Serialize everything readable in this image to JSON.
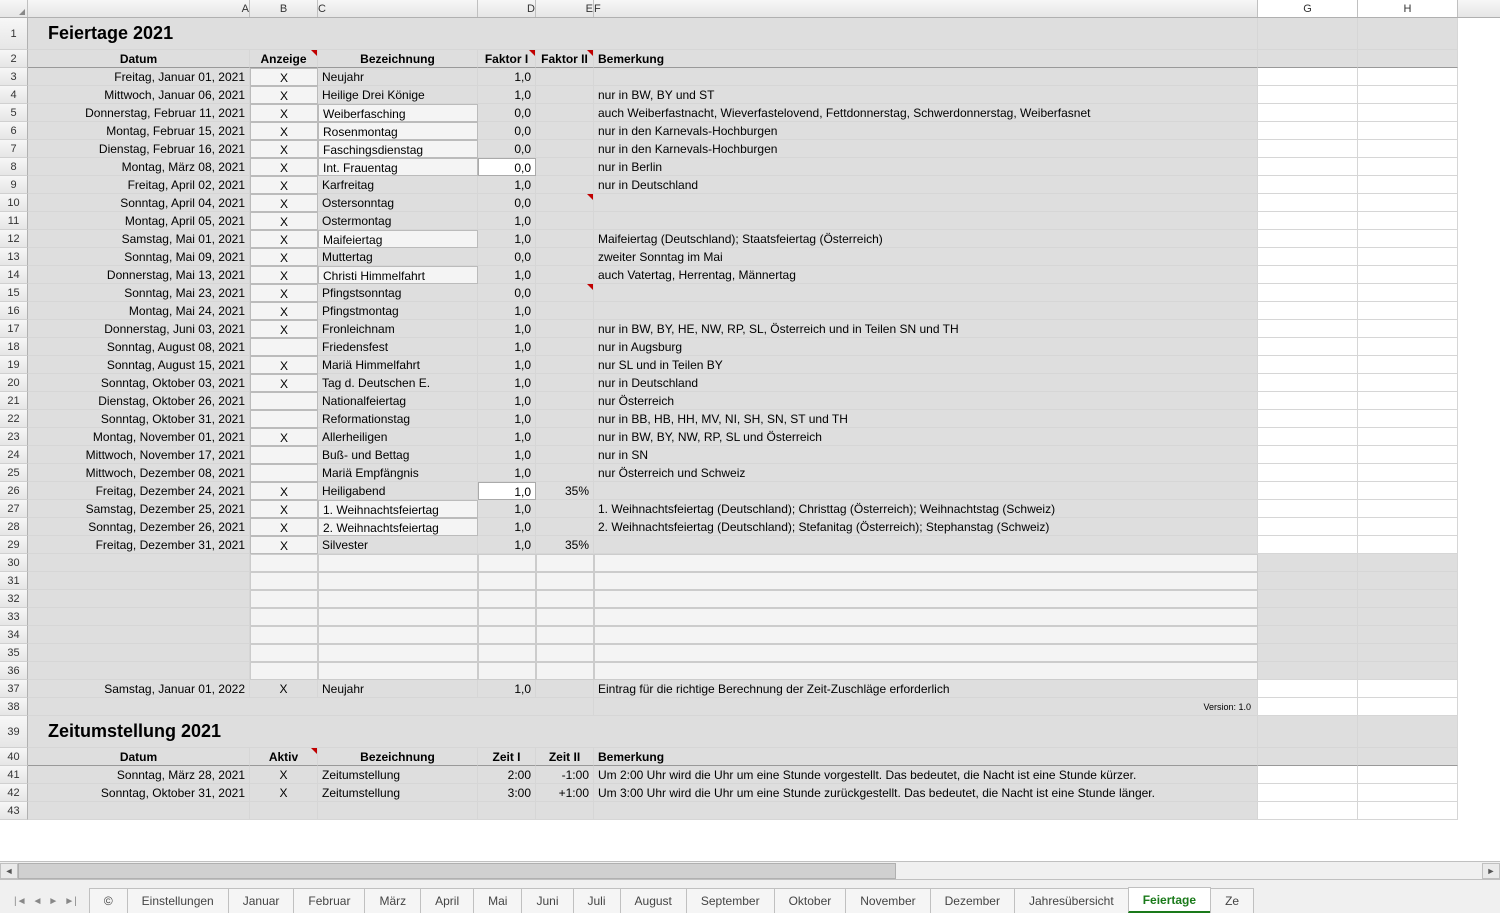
{
  "columns": [
    "A",
    "B",
    "C",
    "D",
    "E",
    "F",
    "G",
    "H"
  ],
  "title1": "Feiertage 2021",
  "title2": "Zeitumstellung 2021",
  "headers1": {
    "a": "Datum",
    "b": "Anzeige",
    "c": "Bezeichnung",
    "d": "Faktor I",
    "e": "Faktor II",
    "f": "Bemerkung"
  },
  "headers2": {
    "a": "Datum",
    "b": "Aktiv",
    "c": "Bezeichnung",
    "d": "Zeit I",
    "e": "Zeit II",
    "f": "Bemerkung"
  },
  "version": "Version: 1.0",
  "rows": [
    {
      "n": 3,
      "a": "Freitag, Januar 01, 2021",
      "b": "X",
      "c": "Neujahr",
      "d": "1,0",
      "e": "",
      "f": ""
    },
    {
      "n": 4,
      "a": "Mittwoch, Januar 06, 2021",
      "b": "X",
      "c": "Heilige Drei Könige",
      "d": "1,0",
      "e": "",
      "f": "nur in BW, BY und ST"
    },
    {
      "n": 5,
      "a": "Donnerstag, Februar 11, 2021",
      "b": "X",
      "c": "Weiberfasching",
      "d": "0,0",
      "e": "",
      "f": "auch Weiberfastnacht, Wieverfastelovend, Fettdonnerstag, Schwerdonnerstag, Weiberfasnet",
      "cedit": true
    },
    {
      "n": 6,
      "a": "Montag, Februar 15, 2021",
      "b": "X",
      "c": "Rosenmontag",
      "d": "0,0",
      "e": "",
      "f": "nur in den Karnevals-Hochburgen",
      "cedit": true
    },
    {
      "n": 7,
      "a": "Dienstag, Februar 16, 2021",
      "b": "X",
      "c": "Faschingsdienstag",
      "d": "0,0",
      "e": "",
      "f": "nur in den Karnevals-Hochburgen",
      "cedit": true
    },
    {
      "n": 8,
      "a": "Montag, März 08, 2021",
      "b": "X",
      "c": "Int. Frauentag",
      "d": "0,0",
      "e": "",
      "f": "nur in Berlin",
      "cedit": true,
      "dwhite": true
    },
    {
      "n": 9,
      "a": "Freitag, April 02, 2021",
      "b": "X",
      "c": "Karfreitag",
      "d": "1,0",
      "e": "",
      "f": "nur in Deutschland"
    },
    {
      "n": 10,
      "a": "Sonntag, April 04, 2021",
      "b": "X",
      "c": "Ostersonntag",
      "d": "0,0",
      "e": "",
      "f": "",
      "emark": true
    },
    {
      "n": 11,
      "a": "Montag, April 05, 2021",
      "b": "X",
      "c": "Ostermontag",
      "d": "1,0",
      "e": "",
      "f": ""
    },
    {
      "n": 12,
      "a": "Samstag, Mai 01, 2021",
      "b": "X",
      "c": "Maifeiertag",
      "d": "1,0",
      "e": "",
      "f": "Maifeiertag (Deutschland); Staatsfeiertag (Österreich)",
      "cedit": true
    },
    {
      "n": 13,
      "a": "Sonntag, Mai 09, 2021",
      "b": "X",
      "c": "Muttertag",
      "d": "0,0",
      "e": "",
      "f": "zweiter Sonntag im Mai"
    },
    {
      "n": 14,
      "a": "Donnerstag, Mai 13, 2021",
      "b": "X",
      "c": "Christi Himmelfahrt",
      "d": "1,0",
      "e": "",
      "f": "auch Vatertag, Herrentag, Männertag",
      "cedit": true
    },
    {
      "n": 15,
      "a": "Sonntag, Mai 23, 2021",
      "b": "X",
      "c": "Pfingstsonntag",
      "d": "0,0",
      "e": "",
      "f": "",
      "emark": true
    },
    {
      "n": 16,
      "a": "Montag, Mai 24, 2021",
      "b": "X",
      "c": "Pfingstmontag",
      "d": "1,0",
      "e": "",
      "f": ""
    },
    {
      "n": 17,
      "a": "Donnerstag, Juni 03, 2021",
      "b": "X",
      "c": "Fronleichnam",
      "d": "1,0",
      "e": "",
      "f": "nur in BW, BY, HE, NW, RP, SL, Österreich und in Teilen SN und TH"
    },
    {
      "n": 18,
      "a": "Sonntag, August 08, 2021",
      "b": "",
      "c": "Friedensfest",
      "d": "1,0",
      "e": "",
      "f": "nur in Augsburg"
    },
    {
      "n": 19,
      "a": "Sonntag, August 15, 2021",
      "b": "X",
      "c": "Mariä Himmelfahrt",
      "d": "1,0",
      "e": "",
      "f": "nur SL und in Teilen BY"
    },
    {
      "n": 20,
      "a": "Sonntag, Oktober 03, 2021",
      "b": "X",
      "c": "Tag d. Deutschen E.",
      "d": "1,0",
      "e": "",
      "f": "nur in Deutschland"
    },
    {
      "n": 21,
      "a": "Dienstag, Oktober 26, 2021",
      "b": "",
      "c": "Nationalfeiertag",
      "d": "1,0",
      "e": "",
      "f": "nur Österreich"
    },
    {
      "n": 22,
      "a": "Sonntag, Oktober 31, 2021",
      "b": "",
      "c": "Reformationstag",
      "d": "1,0",
      "e": "",
      "f": "nur in BB, HB, HH, MV, NI, SH, SN, ST und TH"
    },
    {
      "n": 23,
      "a": "Montag, November 01, 2021",
      "b": "X",
      "c": "Allerheiligen",
      "d": "1,0",
      "e": "",
      "f": "nur in BW, BY, NW, RP, SL und Österreich"
    },
    {
      "n": 24,
      "a": "Mittwoch, November 17, 2021",
      "b": "",
      "c": "Buß- und Bettag",
      "d": "1,0",
      "e": "",
      "f": "nur in SN"
    },
    {
      "n": 25,
      "a": "Mittwoch, Dezember 08, 2021",
      "b": "",
      "c": "Mariä Empfängnis",
      "d": "1,0",
      "e": "",
      "f": "nur Österreich und Schweiz"
    },
    {
      "n": 26,
      "a": "Freitag, Dezember 24, 2021",
      "b": "X",
      "c": "Heiligabend",
      "d": "1,0",
      "e": "35%",
      "f": "",
      "dwhite": true
    },
    {
      "n": 27,
      "a": "Samstag, Dezember 25, 2021",
      "b": "X",
      "c": "1. Weihnachtsfeiertag",
      "d": "1,0",
      "e": "",
      "f": "1. Weihnachtsfeiertag (Deutschland); Christtag (Österreich); Weihnachtstag (Schweiz)",
      "cedit": true
    },
    {
      "n": 28,
      "a": "Sonntag, Dezember 26, 2021",
      "b": "X",
      "c": "2. Weihnachtsfeiertag",
      "d": "1,0",
      "e": "",
      "f": "2. Weihnachtsfeiertag (Deutschland); Stefanitag (Österreich); Stephanstag (Schweiz)",
      "cedit": true
    },
    {
      "n": 29,
      "a": "Freitag, Dezember 31, 2021",
      "b": "X",
      "c": "Silvester",
      "d": "1,0",
      "e": "35%",
      "f": ""
    }
  ],
  "row37": {
    "n": 37,
    "a": "Samstag, Januar 01, 2022",
    "b": "X",
    "c": "Neujahr",
    "d": "1,0",
    "e": "",
    "f": "Eintrag für die richtige Berechnung der Zeit-Zuschläge erforderlich"
  },
  "dst": [
    {
      "n": 41,
      "a": "Sonntag, März 28, 2021",
      "b": "X",
      "c": "Zeitumstellung",
      "d": "2:00",
      "e": "-1:00",
      "f": "Um 2:00 Uhr wird die Uhr um eine Stunde vorgestellt. Das bedeutet, die Nacht ist eine Stunde kürzer."
    },
    {
      "n": 42,
      "a": "Sonntag, Oktober 31, 2021",
      "b": "X",
      "c": "Zeitumstellung",
      "d": "3:00",
      "e": "+1:00",
      "f": "Um 3:00 Uhr wird die Uhr um eine Stunde zurückgestellt. Das bedeutet, die Nacht ist eine Stunde länger."
    }
  ],
  "tabs": [
    "©",
    "Einstellungen",
    "Januar",
    "Februar",
    "März",
    "April",
    "Mai",
    "Juni",
    "Juli",
    "August",
    "September",
    "Oktober",
    "November",
    "Dezember",
    "Jahresübersicht",
    "Feiertage",
    "Ze"
  ],
  "activeTab": "Feiertage"
}
